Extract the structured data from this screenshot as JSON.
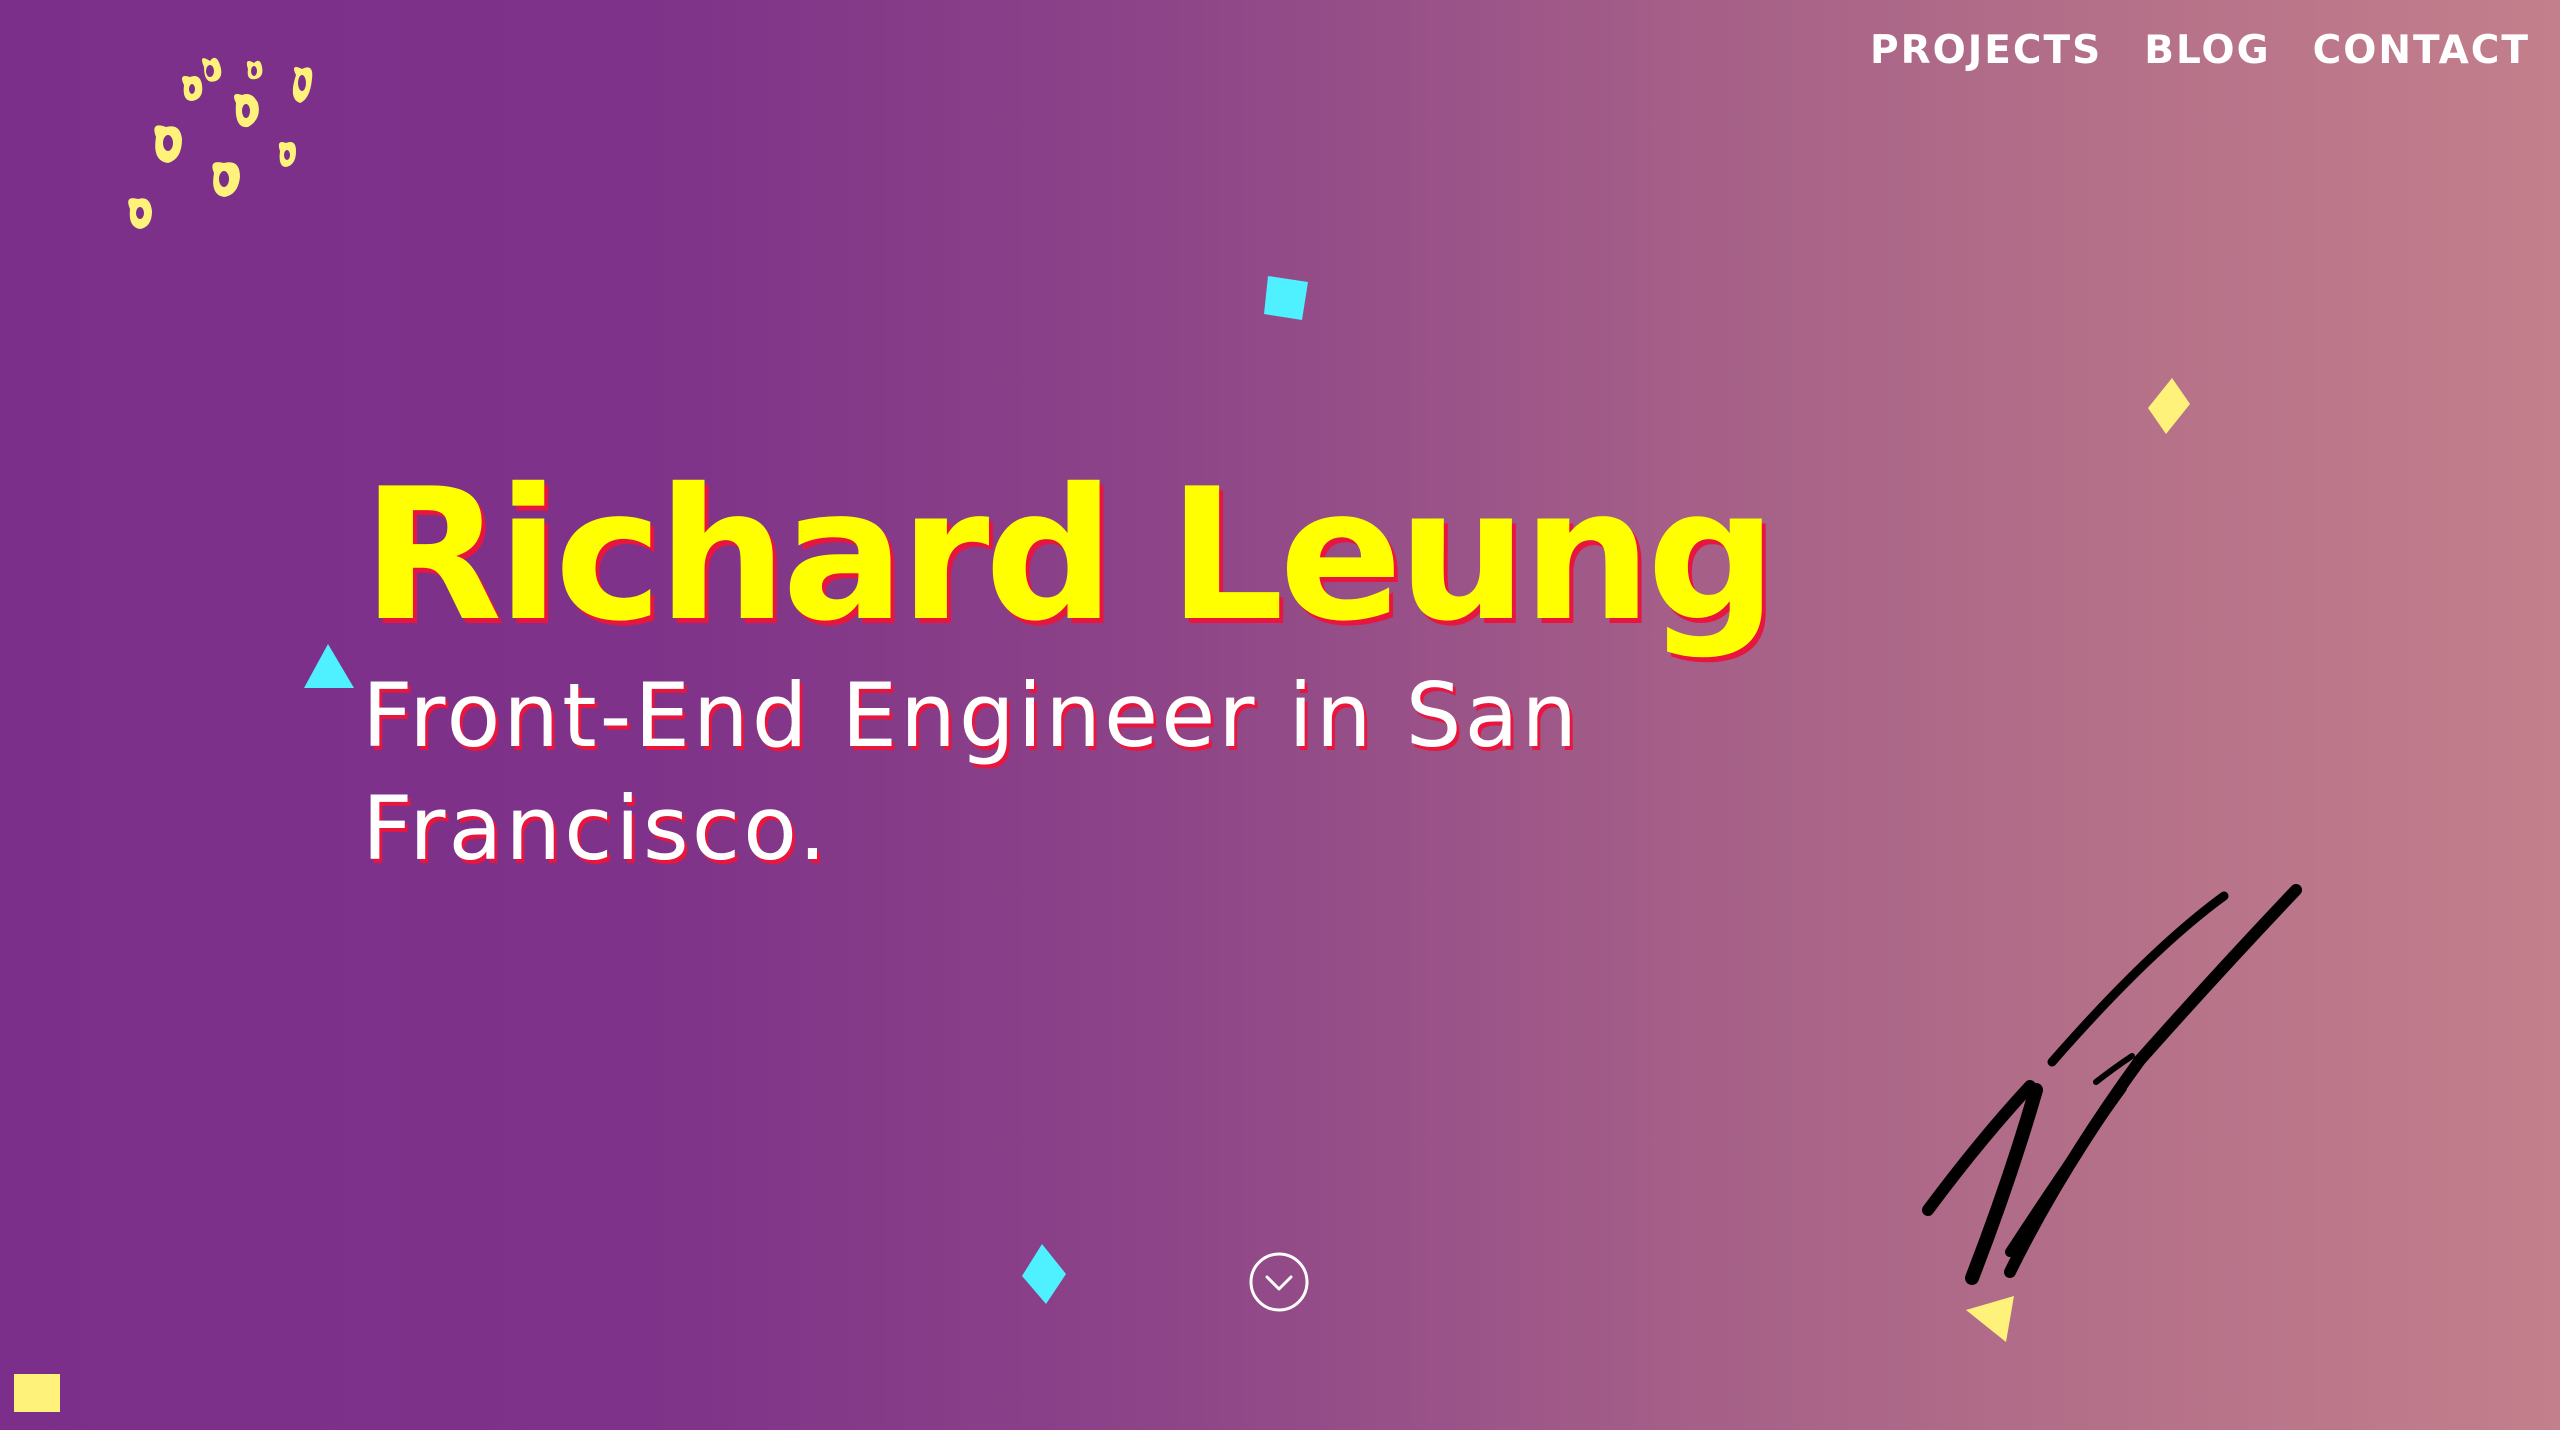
{
  "nav": {
    "items": [
      {
        "label": "PROJECTS"
      },
      {
        "label": "BLOG"
      },
      {
        "label": "CONTACT"
      }
    ]
  },
  "hero": {
    "name": "Richard Leung",
    "subtitle": "Front-End Engineer in San Francisco."
  },
  "icons": {
    "logo": "paw-print-logo",
    "scroll": "chevron-down-circle-icon",
    "signature": "signature-graphic"
  },
  "colors": {
    "gradient_start": "#7b2f8a",
    "gradient_end": "#c47f8c",
    "name": "#ffff00",
    "text_shadow": "#e8163f",
    "nav_text": "#ffffff",
    "confetti_yellow": "#fff27a",
    "confetti_cyan": "#4ff0ff"
  }
}
